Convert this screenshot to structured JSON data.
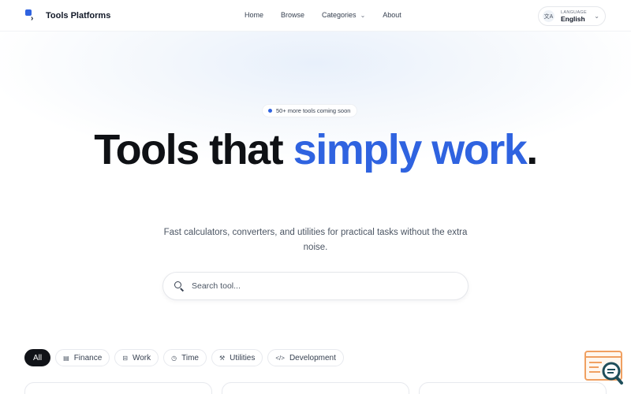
{
  "brand": {
    "name": "Tools Platforms"
  },
  "nav": {
    "items": [
      {
        "label": "Home"
      },
      {
        "label": "Browse"
      },
      {
        "label": "Categories",
        "dropdown": true
      },
      {
        "label": "About"
      }
    ]
  },
  "language": {
    "label": "LANGUAGE",
    "value": "English"
  },
  "hero": {
    "badge": "50+ more tools coming soon",
    "headline_part1": "Tools that ",
    "headline_accent": "simply work",
    "headline_end": ".",
    "subtitle": "Fast calculators, converters, and utilities for practical tasks without the extra noise."
  },
  "search": {
    "placeholder": "Search tool..."
  },
  "filters": [
    {
      "label": "All",
      "active": true
    },
    {
      "label": "Finance",
      "icon": "receipt-icon"
    },
    {
      "label": "Work",
      "icon": "briefcase-icon"
    },
    {
      "label": "Time",
      "icon": "clock-icon"
    },
    {
      "label": "Utilities",
      "icon": "wrench-icon"
    },
    {
      "label": "Development",
      "icon": "code-icon"
    }
  ],
  "colors": {
    "accent": "#2f63e0",
    "dark": "#111318",
    "widget": "#f0a061"
  }
}
